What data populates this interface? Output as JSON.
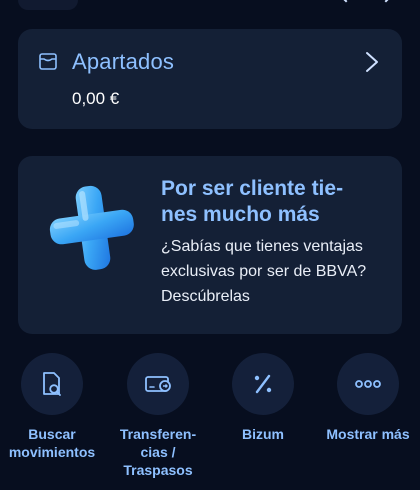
{
  "apartados": {
    "title": "Apartados",
    "amount": "0,00 €"
  },
  "promo": {
    "title": "Por ser cliente tie-\nnes mucho más",
    "body": "¿Sabías que tienes ventajas\nexclusivas por ser de BBVA?\nDescúbrelas"
  },
  "actions": [
    {
      "label": "Buscar\nmovimientos",
      "icon": "search-document-icon"
    },
    {
      "label": "Transferen-\ncias /\nTraspasos",
      "icon": "transfer-icon"
    },
    {
      "label": "Bizum",
      "icon": "bizum-icon"
    },
    {
      "label": "Mostrar más",
      "icon": "more-icon"
    }
  ],
  "colors": {
    "background": "#070e1f",
    "card": "#142036",
    "accent": "#8ec0ff",
    "text": "#ffffff"
  }
}
